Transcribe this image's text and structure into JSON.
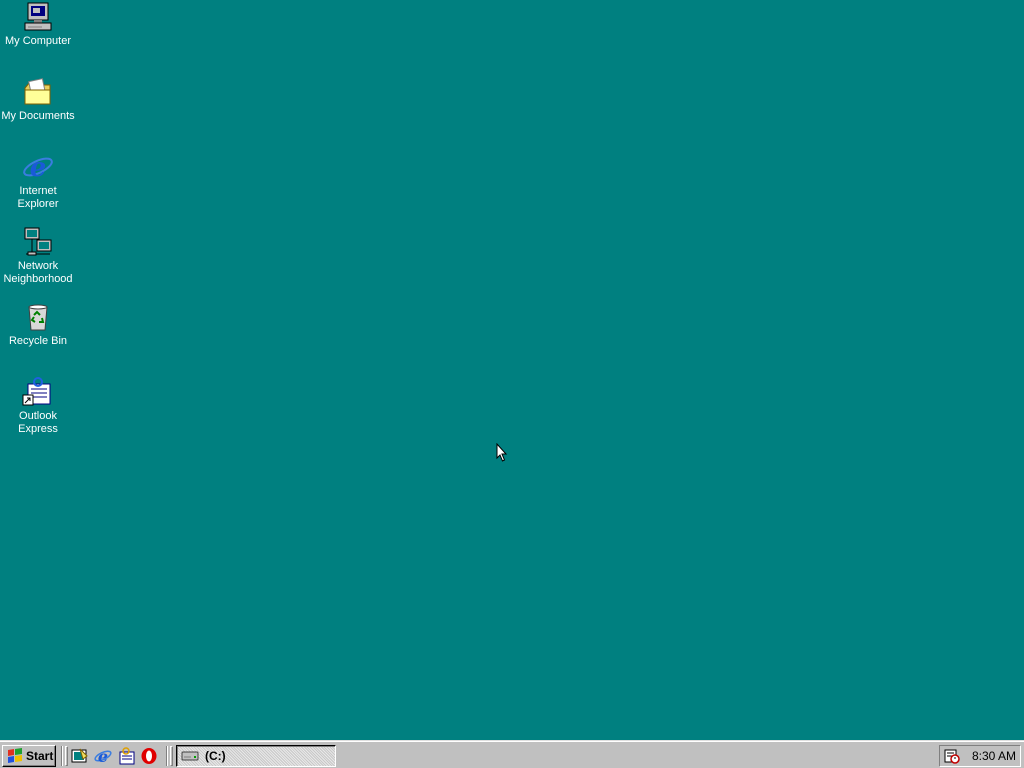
{
  "desktop": {
    "background": "#008080",
    "icons": [
      {
        "label": "My Computer",
        "icon": "my-computer-icon"
      },
      {
        "label": "My Documents",
        "icon": "folder-icon"
      },
      {
        "label": "Internet Explorer",
        "icon": "internet-explorer-icon"
      },
      {
        "label": "Network Neighborhood",
        "icon": "network-icon"
      },
      {
        "label": "Recycle Bin",
        "icon": "recycle-bin-icon"
      },
      {
        "label": "Outlook Express",
        "icon": "outlook-express-icon"
      }
    ]
  },
  "taskbar": {
    "start_label": "Start",
    "quick_launch": [
      {
        "icon": "show-desktop-icon"
      },
      {
        "icon": "internet-explorer-icon"
      },
      {
        "icon": "outlook-express-icon"
      },
      {
        "icon": "opera-icon"
      }
    ],
    "tasks": [
      {
        "label": "(C:)",
        "icon": "drive-icon",
        "active": true
      }
    ],
    "tray": {
      "icons": [
        "scheduler-icon"
      ],
      "clock": "8:30 AM"
    }
  }
}
